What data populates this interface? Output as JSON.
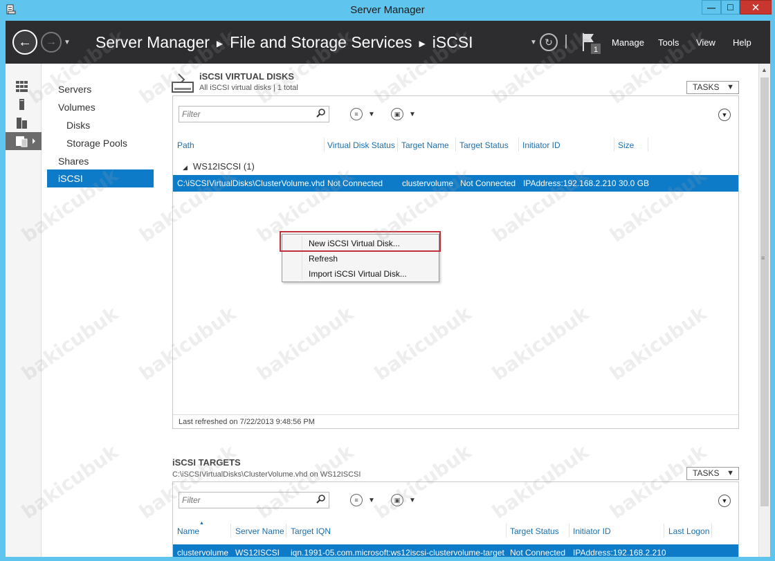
{
  "window": {
    "title": "Server Manager",
    "min_symbol": "—",
    "max_symbol": "☐",
    "close_symbol": "✕"
  },
  "header": {
    "breadcrumb": [
      "Server Manager",
      "File and Storage Services",
      "iSCSI"
    ],
    "flag_count": "1",
    "menus": [
      "Manage",
      "Tools",
      "View",
      "Help"
    ]
  },
  "nav": {
    "items": [
      {
        "label": "Servers"
      },
      {
        "label": "Volumes"
      },
      {
        "label": "Disks"
      },
      {
        "label": "Storage Pools"
      },
      {
        "label": "Shares"
      },
      {
        "label": "iSCSI"
      }
    ]
  },
  "virtual_disks": {
    "title": "iSCSI VIRTUAL DISKS",
    "subtitle": "All iSCSI virtual disks | 1 total",
    "tasks_label": "TASKS",
    "filter_placeholder": "Filter",
    "columns": [
      "Path",
      "Virtual Disk Status",
      "Target Name",
      "Target Status",
      "Initiator ID",
      "Size"
    ],
    "group_label": "WS12ISCSI (1)",
    "row": {
      "path": "C:\\iSCSIVirtualDisks\\ClusterVolume.vhd",
      "status": "Not Connected",
      "target_name": "clustervolume",
      "target_status": "Not Connected",
      "initiator_id": "IPAddress:192.168.2.210",
      "size": "30.0 GB"
    },
    "last_refreshed": "Last refreshed on 7/22/2013 9:48:56 PM"
  },
  "context_menu": {
    "items": [
      "New iSCSI Virtual Disk...",
      "Refresh",
      "Import iSCSI Virtual Disk..."
    ]
  },
  "targets": {
    "title": "iSCSI TARGETS",
    "subtitle": "C:\\iSCSIVirtualDisks\\ClusterVolume.vhd on WS12ISCSI",
    "tasks_label": "TASKS",
    "filter_placeholder": "Filter",
    "columns": [
      "Name",
      "Server Name",
      "Target IQN",
      "Target Status",
      "Initiator ID",
      "Last Logon"
    ],
    "row": {
      "name": "clustervolume",
      "server": "WS12ISCSI",
      "iqn": "iqn.1991-05.com.microsoft:ws12iscsi-clustervolume-target",
      "status": "Not Connected",
      "initiator": "IPAddress:192.168.2.210"
    }
  },
  "watermark": "bakicubuk",
  "colors": {
    "accent": "#0e7bc9",
    "frame": "#5fc5ee",
    "header_bg": "#2d2d30",
    "highlight_border": "#c0303a"
  }
}
